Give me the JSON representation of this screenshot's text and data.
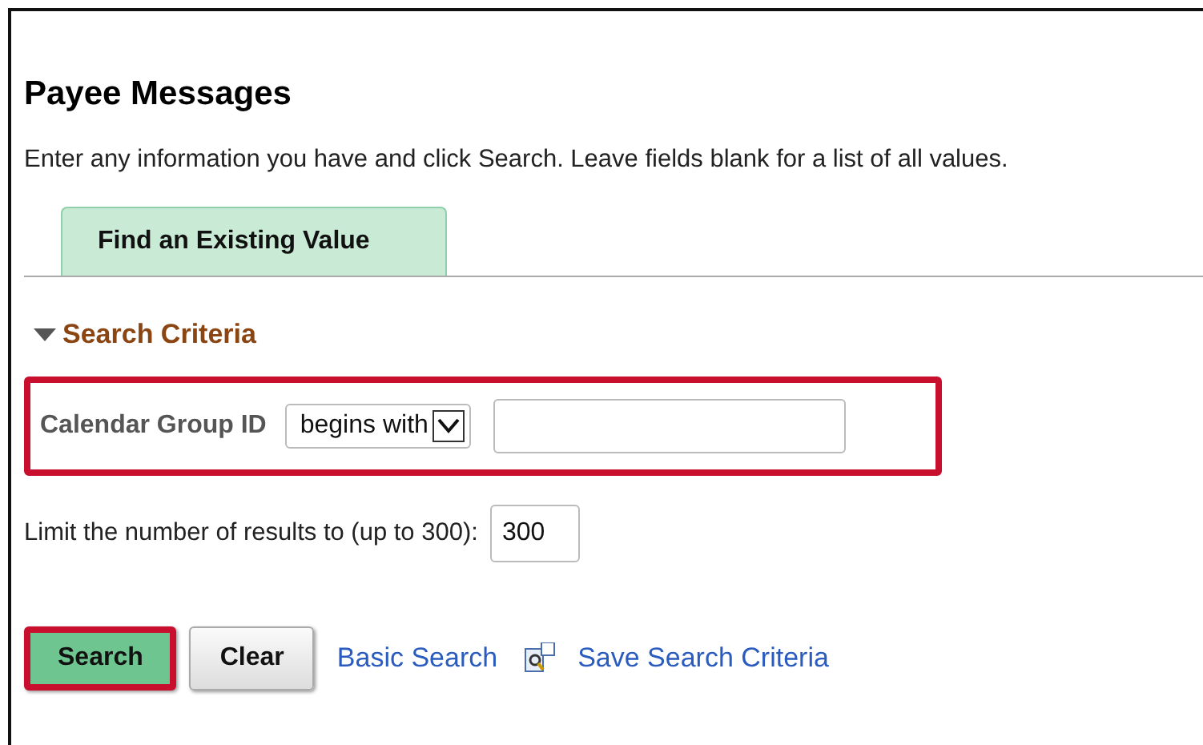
{
  "page": {
    "title": "Payee Messages",
    "instructions": "Enter any information you have and click Search. Leave fields blank for a list of all values."
  },
  "tabs": [
    {
      "label": "Find an Existing Value",
      "selected": true
    }
  ],
  "search_criteria": {
    "heading": "Search Criteria",
    "expanded": true,
    "fields": [
      {
        "label": "Calendar Group ID",
        "operator": "begins with",
        "highlighted": true
      }
    ]
  },
  "limit": {
    "label": "Limit the number of results to (up to 300):",
    "value": "300"
  },
  "buttons": [
    {
      "label": "Search",
      "kind": "primary",
      "highlighted": true
    },
    {
      "label": "Clear",
      "kind": "secondary",
      "highlighted": false
    }
  ],
  "links": [
    {
      "label": "Basic Search",
      "icon": false
    },
    {
      "label": "Save Search Criteria",
      "icon": true
    }
  ]
}
